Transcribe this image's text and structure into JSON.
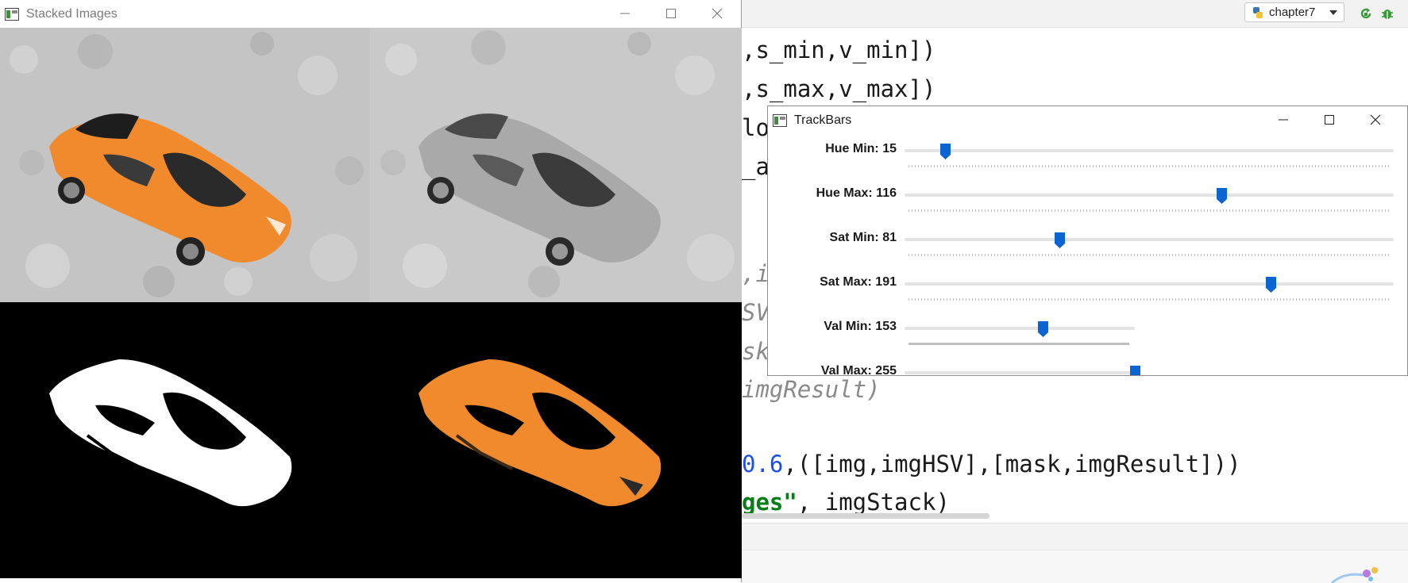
{
  "ide": {
    "run_config_label": "chapter7",
    "code_lines": [
      {
        "text": ",s_min,v_min])",
        "style": "plain"
      },
      {
        "text": ",s_max,v_max])",
        "style": "plain"
      },
      {
        "text": "lo",
        "style": "plain"
      },
      {
        "text": "_a",
        "style": "plain"
      },
      {
        "text": ",i",
        "style": "gray"
      },
      {
        "text": "SV",
        "style": "gray"
      },
      {
        "text": "sk",
        "style": "gray"
      },
      {
        "text": "imgResult)",
        "style": "gray"
      },
      {
        "num": "0.6",
        "rest": ",([img,imgHSV],[mask,imgResult]))"
      },
      {
        "str": "ges\"",
        "rest": ", imgStack)"
      }
    ]
  },
  "stacked_window": {
    "title": "Stacked Images",
    "tiles": [
      "original-image",
      "hsv-image",
      "mask-image",
      "result-image"
    ]
  },
  "trackbars_window": {
    "title": "TrackBars",
    "sliders": [
      {
        "label": "Hue Min: 15",
        "value": 15,
        "max": 179
      },
      {
        "label": "Hue Max: 116",
        "value": 116,
        "max": 179
      },
      {
        "label": "Sat Min: 81",
        "value": 81,
        "max": 255
      },
      {
        "label": "Sat Max: 191",
        "value": 191,
        "max": 255
      },
      {
        "label": "Val Min: 153",
        "value": 153,
        "max": 255
      },
      {
        "label": "Val Max: 255",
        "value": 255,
        "max": 255
      }
    ]
  },
  "colors": {
    "car_orange": "#f08a2c",
    "slider_blue": "#0a64d2",
    "carpet": "#c8c8c8",
    "mask_bg": "#000000"
  },
  "icons": [
    "window-icon",
    "minimize-icon",
    "maximize-icon",
    "close-icon",
    "python-icon",
    "rerun-icon",
    "debug-icon"
  ]
}
